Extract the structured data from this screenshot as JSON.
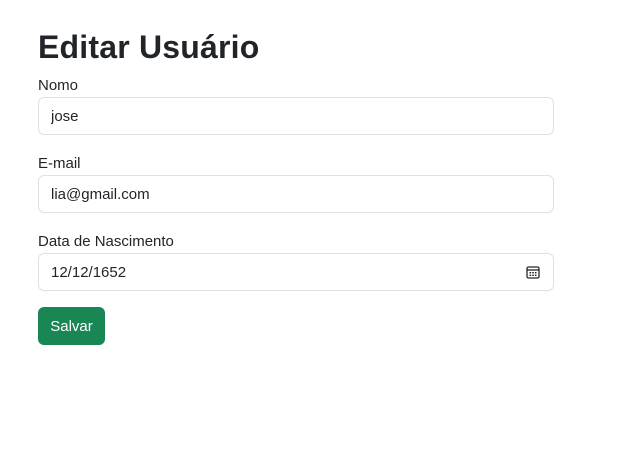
{
  "page": {
    "title": "Editar Usuário"
  },
  "form": {
    "name": {
      "label": "Nomo",
      "value": "jose"
    },
    "email": {
      "label": "E-mail",
      "value": "lia@gmail.com"
    },
    "birthdate": {
      "label": "Data de Nascimento",
      "value": "12/12/1652",
      "icon": "calendar-icon"
    },
    "submit_label": "Salvar"
  },
  "colors": {
    "primary_button": "#198754",
    "border": "#dee2e6",
    "text": "#212529"
  }
}
